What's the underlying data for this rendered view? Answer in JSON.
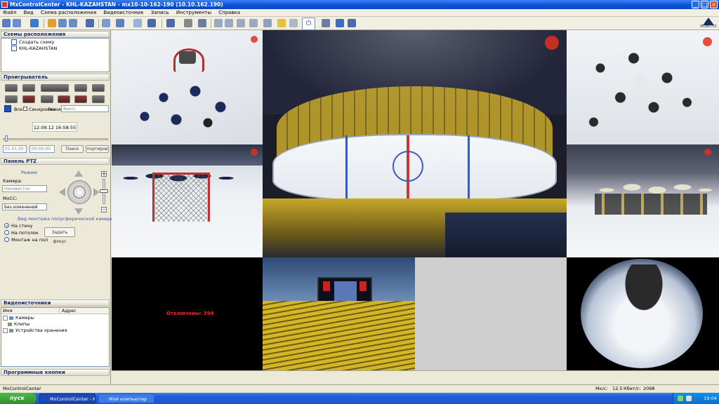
{
  "window": {
    "title": "MxControlCenter - KHL-KAZAHSTAN - mx10-10-162-190 (10.10.162.190)",
    "controls": {
      "minimize": "_",
      "maximize": "□",
      "close": "×"
    }
  },
  "menu": [
    "Файл",
    "Вид",
    "Схема расположения",
    "Видеоисточник",
    "Запись",
    "Инструменты",
    "Справка"
  ],
  "brand": {
    "logo_text": "MOBOTIX",
    "accent": "#1f4fbf"
  },
  "layouts_panel": {
    "title": "Схемы расположения",
    "items": [
      "Создать схему",
      "KHL-KAZAHSTAN"
    ]
  },
  "player_panel": {
    "title": "Проигрыватель",
    "all_label": "Все",
    "sync_label": "Синхрониз.",
    "mode_label": "Режим:",
    "mode_value": "Выкл.",
    "datetime": "12.09.12 16:58:55",
    "date_field": "01.01.00",
    "time_field": "00:00:00",
    "search_button": "Поиск",
    "export_button": "портиров"
  },
  "ptz_panel": {
    "title": "Панель PTZ",
    "mode_label": "Режим",
    "camera_label": "Камера:",
    "camera_value": "Неизвестно",
    "mxcc_label": "MxCC:",
    "mxcc_value": "Без изменений",
    "mount_label": "Вид монтажа полусферической камеры",
    "mount_options": [
      "На стену",
      "На потолок",
      "Монтаж на пол"
    ],
    "mount_selected": "На стену",
    "focus_button": "Задать фокус",
    "zoom_plus": "+",
    "zoom_minus": "-"
  },
  "sources_panel": {
    "title": "Видеоисточники",
    "columns": [
      "Имя",
      "Адрес"
    ],
    "items": [
      "Камеры",
      "Клипы",
      "Устройства хранения"
    ]
  },
  "soft_buttons_panel": {
    "title": "Программные кнопки"
  },
  "cameras": {
    "disconnected_text": "Отключены: 394"
  },
  "status": {
    "left": "MxControlCenter",
    "fps_label": "Мк/с:",
    "fps_value": "12.5",
    "kbps_label": "Кбит/с:",
    "kbps_value": "2098"
  },
  "taskbar": {
    "start": "пуск",
    "tasks": [
      "MxControlCenter - К...",
      "Мой компьютер"
    ],
    "clock": "19:04"
  }
}
